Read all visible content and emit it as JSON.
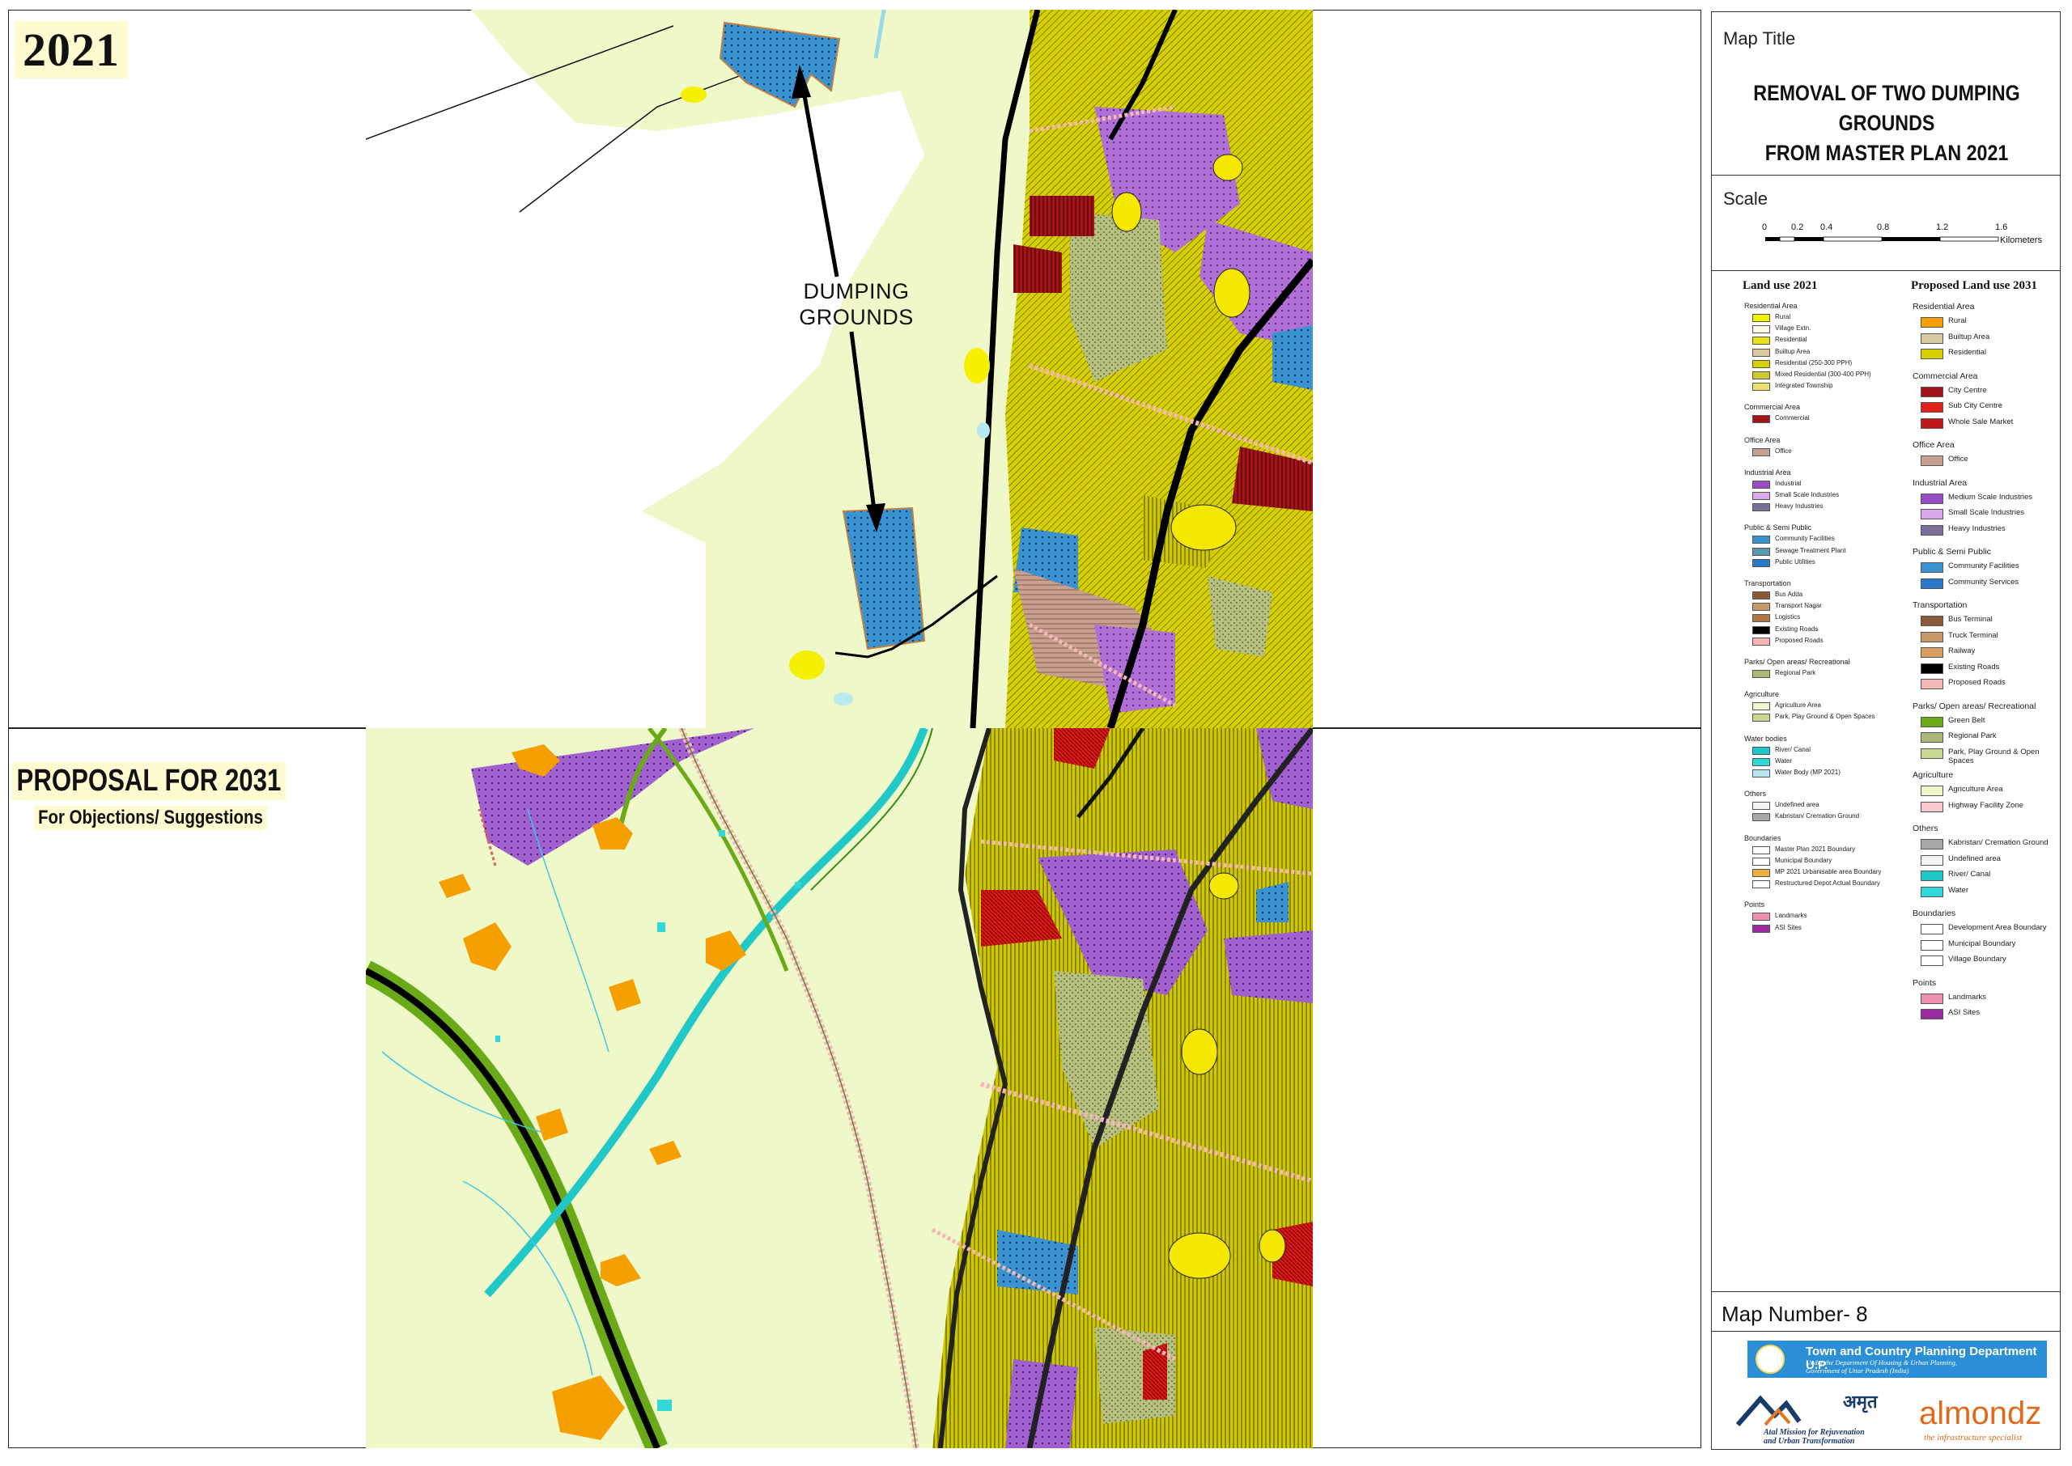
{
  "panels": {
    "top_year": "2021",
    "bottom_title": "PROPOSAL FOR 2031",
    "bottom_subtitle": "For Objections/ Suggestions",
    "annotation": "DUMPING GROUNDS"
  },
  "title_block": {
    "caption": "Map Title",
    "title_line1": "REMOVAL OF TWO DUMPING GROUNDS",
    "title_line2": "FROM MASTER PLAN 2021"
  },
  "scale_bar": {
    "caption": "Scale",
    "ticks": [
      "0",
      "0.2",
      "0.4",
      "0.8",
      "1.2",
      "1.6"
    ],
    "unit": "Kilometers"
  },
  "legend_2021": {
    "heading": "Land use 2021",
    "sections": [
      {
        "title": "Residential Area",
        "items": [
          {
            "label": "Rural",
            "color": "#f5f000"
          },
          {
            "label": "Village Extn.",
            "color": "#fffbe0"
          },
          {
            "label": "Residential",
            "color": "#e6e21e"
          },
          {
            "label": "Builtup Area",
            "color": "#d8c9a0"
          },
          {
            "label": "Residential (250-300 PPH)",
            "color": "#d6d000"
          },
          {
            "label": "Mixed Residential (300-400 PPH)",
            "color": "#cfc830"
          },
          {
            "label": "Integrated Township",
            "color": "#e8e070"
          }
        ]
      },
      {
        "title": "Commercial Area",
        "items": [
          {
            "label": "Commercial",
            "color": "#a0141a"
          }
        ]
      },
      {
        "title": "Office Area",
        "items": [
          {
            "label": "Office",
            "color": "#c8a090"
          }
        ]
      },
      {
        "title": "Industrial Area",
        "items": [
          {
            "label": "Industrial",
            "color": "#9a4ec4"
          },
          {
            "label": "Small Scale Industries",
            "color": "#d9a8e8"
          },
          {
            "label": "Heavy Industries",
            "color": "#7a6e9a"
          }
        ]
      },
      {
        "title": "Public & Semi Public",
        "items": [
          {
            "label": "Community Facilities",
            "color": "#3a92d0"
          },
          {
            "label": "Sewage Treatment Plant",
            "color": "#5a9ab0"
          },
          {
            "label": "Public Utilities",
            "color": "#2a78c8"
          }
        ]
      },
      {
        "title": "Transportation",
        "items": [
          {
            "label": "Bus Adda",
            "color": "#8a5a3a"
          },
          {
            "label": "Transport Nagar",
            "color": "#c89868"
          },
          {
            "label": "Logistics",
            "color": "#b07848"
          },
          {
            "label": "Existing Roads",
            "color": "#000000"
          },
          {
            "label": "Proposed Roads",
            "color": "#f2b8b8"
          }
        ]
      },
      {
        "title": "Parks/ Open areas/ Recreational",
        "items": [
          {
            "label": "Regional Park",
            "color": "#a8b878"
          }
        ]
      },
      {
        "title": "Agriculture",
        "items": [
          {
            "label": "Agriculture Area",
            "color": "#eef8c8"
          },
          {
            "label": "Park, Play Ground & Open Spaces",
            "color": "#c8d890"
          }
        ]
      },
      {
        "title": "Water bodies",
        "items": [
          {
            "label": "River/ Canal",
            "color": "#20c8c8"
          },
          {
            "label": "Water",
            "color": "#30d8d8"
          },
          {
            "label": "Water Body (MP 2021)",
            "color": "#b8e8f0"
          }
        ]
      },
      {
        "title": "Others",
        "items": [
          {
            "label": "Undefined area",
            "color": "#f4f4f4"
          },
          {
            "label": "Kabristan/ Cremation Ground",
            "color": "#a8a8a8"
          }
        ]
      },
      {
        "title": "Boundaries",
        "items": [
          {
            "label": "Master Plan 2021 Boundary",
            "color": "#ffffff"
          },
          {
            "label": "Municipal Boundary",
            "color": "#ffffff"
          },
          {
            "label": "MP 2021 Urbanisable area Boundary",
            "color": "#f0b040"
          },
          {
            "label": "Restructured Depot Actual Boundary",
            "color": "#ffffff"
          }
        ]
      },
      {
        "title": "Points",
        "items": [
          {
            "label": "Landmarks",
            "color": "#f090b0"
          },
          {
            "label": "ASI Sites",
            "color": "#9a2aa0"
          }
        ]
      }
    ]
  },
  "legend_2031": {
    "heading": "Proposed Land use 2031",
    "sections": [
      {
        "title": "Residential Area",
        "items": [
          {
            "label": "Rural",
            "color": "#f5a000"
          },
          {
            "label": "Builtup Area",
            "color": "#d8c9a0"
          },
          {
            "label": "Residential",
            "color": "#d6d000"
          }
        ]
      },
      {
        "title": "Commercial Area",
        "items": [
          {
            "label": "City Centre",
            "color": "#a0141a"
          },
          {
            "label": "Sub City Centre",
            "color": "#e0201a"
          },
          {
            "label": "Whole Sale Market",
            "color": "#c01818"
          }
        ]
      },
      {
        "title": "Office Area",
        "items": [
          {
            "label": "Office",
            "color": "#c8a090"
          }
        ]
      },
      {
        "title": "Industrial Area",
        "items": [
          {
            "label": "Medium Scale Industries",
            "color": "#9a4ec4"
          },
          {
            "label": "Small Scale Industries",
            "color": "#d9a8e8"
          },
          {
            "label": "Heavy Industries",
            "color": "#7a6e9a"
          }
        ]
      },
      {
        "title": "Public & Semi Public",
        "items": [
          {
            "label": "Community Facilities",
            "color": "#3a92d0"
          },
          {
            "label": "Community Services",
            "color": "#2a78c8"
          }
        ]
      },
      {
        "title": "Transportation",
        "items": [
          {
            "label": "Bus Terminal",
            "color": "#8a5a3a"
          },
          {
            "label": "Truck Terminal",
            "color": "#c89868"
          },
          {
            "label": "Railway",
            "color": "#d8a060"
          },
          {
            "label": "Existing Roads",
            "color": "#000000"
          },
          {
            "label": "Proposed Roads",
            "color": "#f2b8b8"
          }
        ]
      },
      {
        "title": "Parks/ Open areas/ Recreational",
        "items": [
          {
            "label": "Green Belt",
            "color": "#6aaa18"
          },
          {
            "label": "Regional Park",
            "color": "#a8b878"
          },
          {
            "label": "Park, Play Ground & Open Spaces",
            "color": "#c8d890"
          }
        ]
      },
      {
        "title": "Agriculture",
        "items": [
          {
            "label": "Agriculture Area",
            "color": "#eef8c8"
          },
          {
            "label": "Highway Facility Zone",
            "color": "#f8c8d0"
          }
        ]
      },
      {
        "title": "Others",
        "items": [
          {
            "label": "Kabristan/ Cremation Ground",
            "color": "#a8a8a8"
          },
          {
            "label": "Undefined area",
            "color": "#f4f4f4"
          },
          {
            "label": "River/ Canal",
            "color": "#20c8c8"
          },
          {
            "label": "Water",
            "color": "#30d8d8"
          }
        ]
      },
      {
        "title": "Boundaries",
        "items": [
          {
            "label": "Development Area Boundary",
            "color": "#ffffff"
          },
          {
            "label": "Municipal Boundary",
            "color": "#ffffff"
          },
          {
            "label": "Village Boundary",
            "color": "#ffffff"
          }
        ]
      },
      {
        "title": "Points",
        "items": [
          {
            "label": "Landmarks",
            "color": "#f090b0"
          },
          {
            "label": "ASI Sites",
            "color": "#9a2aa0"
          }
        ]
      }
    ]
  },
  "footer": {
    "map_number": "Map Number- 8",
    "department": "Town and Country Planning Department U.P.",
    "department_sub_1": "Under the Department Of Housing & Urban Planning,",
    "department_sub_2": "Government of Uttar Pradesh (India)",
    "amrut_hindi": "अमृत",
    "amrut_line1": "Atal Mission for Rejuvenation",
    "amrut_line2": "and Urban Transformation",
    "consultant": "almondz",
    "consultant_tag": "the infrastructure specialist"
  },
  "colors": {
    "agriculture": "#eef8c8",
    "residential_yellow": "#d6d000",
    "industrial_purple": "#9a4ec4",
    "dumping_blue": "#3a92d0",
    "rural_orange": "#f5a000",
    "commercial_red": "#b01818",
    "canal": "#20c8c8",
    "green_belt": "#6aaa18"
  }
}
